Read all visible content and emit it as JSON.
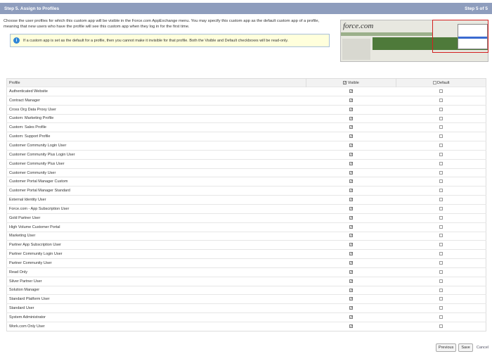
{
  "header": {
    "title": "Step 5. Assign to Profiles",
    "step": "Step 5 of 5"
  },
  "intro": "Choose the user profiles for which this custom app will be visible in the Force.com AppExchange menu. You may specify this custom app as the default custom app of a profile, meaning that new users who have the profile will see this custom app when they log in for the first time.",
  "info": {
    "icon": "info-icon",
    "text": "If a custom app is set as the default for a profile, then you cannot make it invisible for that profile. Both the Visible and Default checkboxes will be read-only."
  },
  "thumbnail": {
    "logo": "force.com"
  },
  "table": {
    "headers": {
      "profile": "Profile",
      "visible": "Visible",
      "default": "Default"
    },
    "rows": [
      {
        "name": "Authenticated Website",
        "visible": true,
        "default": false
      },
      {
        "name": "Contract Manager",
        "visible": true,
        "default": false
      },
      {
        "name": "Cross Org Data Proxy User",
        "visible": true,
        "default": false
      },
      {
        "name": "Custom: Marketing Profile",
        "visible": true,
        "default": false
      },
      {
        "name": "Custom: Sales Profile",
        "visible": true,
        "default": false
      },
      {
        "name": "Custom: Support Profile",
        "visible": true,
        "default": false
      },
      {
        "name": "Customer Community Login User",
        "visible": true,
        "default": false
      },
      {
        "name": "Customer Community Plus Login User",
        "visible": true,
        "default": false
      },
      {
        "name": "Customer Community Plus User",
        "visible": true,
        "default": false
      },
      {
        "name": "Customer Community User",
        "visible": true,
        "default": false
      },
      {
        "name": "Customer Portal Manager Custom",
        "visible": true,
        "default": false
      },
      {
        "name": "Customer Portal Manager Standard",
        "visible": true,
        "default": false
      },
      {
        "name": "External Identity User",
        "visible": true,
        "default": false
      },
      {
        "name": "Force.com - App Subscription User",
        "visible": true,
        "default": false
      },
      {
        "name": "Gold Partner User",
        "visible": true,
        "default": false
      },
      {
        "name": "High Volume Customer Portal",
        "visible": true,
        "default": false
      },
      {
        "name": "Marketing User",
        "visible": true,
        "default": false
      },
      {
        "name": "Partner App Subscription User",
        "visible": true,
        "default": false
      },
      {
        "name": "Partner Community Login User",
        "visible": true,
        "default": false
      },
      {
        "name": "Partner Community User",
        "visible": true,
        "default": false
      },
      {
        "name": "Read Only",
        "visible": true,
        "default": false
      },
      {
        "name": "Silver Partner User",
        "visible": true,
        "default": false
      },
      {
        "name": "Solution Manager",
        "visible": true,
        "default": false
      },
      {
        "name": "Standard Platform User",
        "visible": true,
        "default": false
      },
      {
        "name": "Standard User",
        "visible": true,
        "default": false
      },
      {
        "name": "System Administrator",
        "visible": true,
        "default": false
      },
      {
        "name": "Work.com Only User",
        "visible": true,
        "default": false
      }
    ]
  },
  "buttons": {
    "previous": "Previous",
    "save": "Save",
    "cancel": "Cancel"
  }
}
